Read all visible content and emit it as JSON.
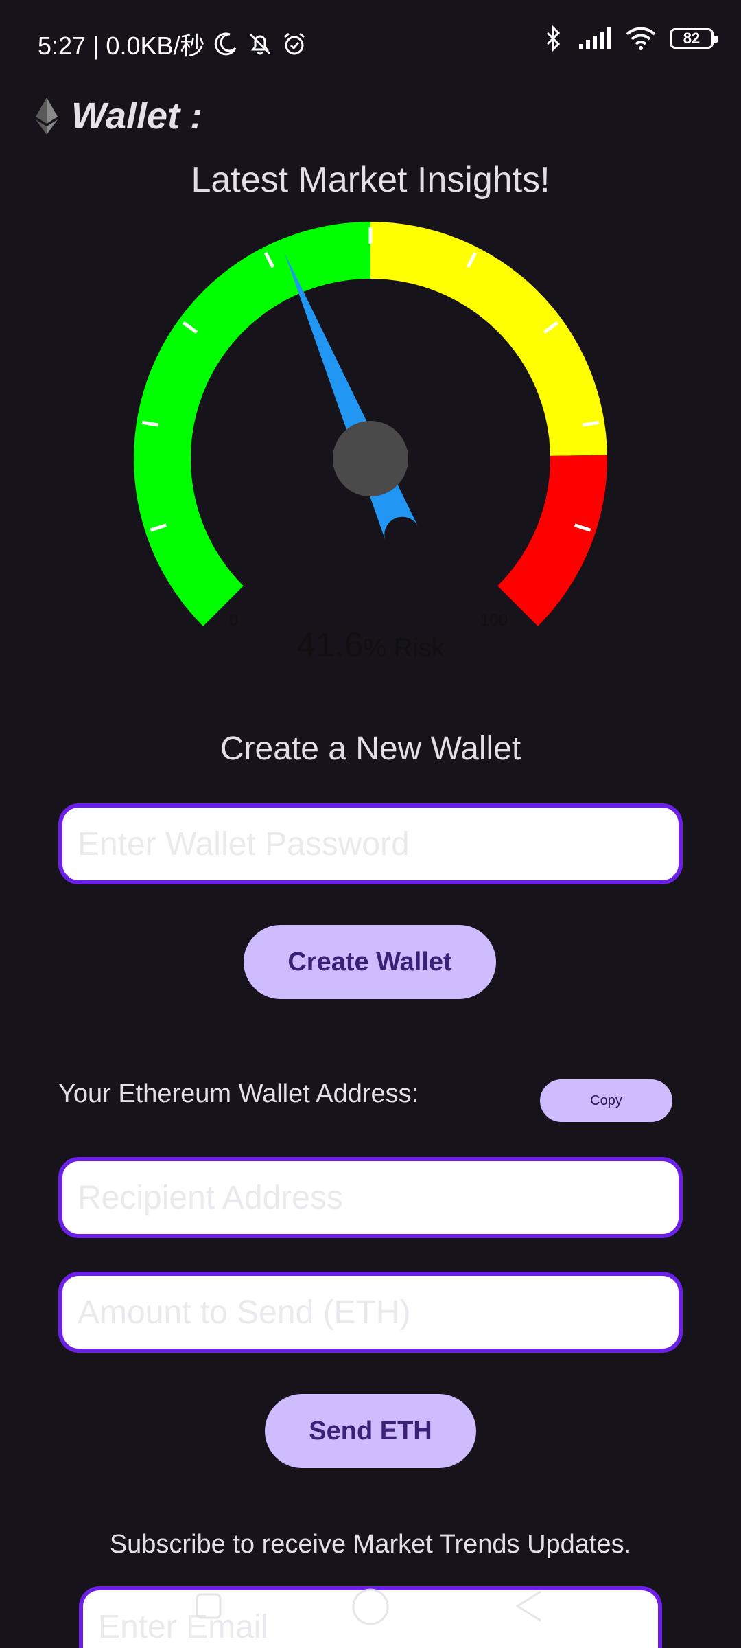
{
  "status_bar": {
    "time_speed": "5:27 | 0.0KB/秒",
    "battery": "82",
    "icons": [
      "moon-icon",
      "notifications-off-icon",
      "alarm-icon",
      "bluetooth-icon",
      "signal-icon",
      "wifi-icon",
      "battery-icon"
    ]
  },
  "header": {
    "title": "Wallet :",
    "logo_icon": "ethereum-icon"
  },
  "insights": {
    "title": "Latest Market Insights!"
  },
  "gauge": {
    "min_label": "0",
    "max_label": "100",
    "value": "41.6",
    "unit_label": "% Risk",
    "risk_percent": 41.6,
    "zones": [
      {
        "color": "#00ff00",
        "from": 0,
        "to": 50
      },
      {
        "color": "#ffff00",
        "from": 50,
        "to": 83
      },
      {
        "color": "#ff0000",
        "from": 83,
        "to": 100
      }
    ],
    "needle_color": "#2196f3",
    "hub_color": "#4a4a4a"
  },
  "create_wallet": {
    "title": "Create a New Wallet",
    "password_placeholder": "Enter Wallet Password",
    "button_label": "Create Wallet"
  },
  "wallet_address": {
    "label": "Your Ethereum Wallet Address:",
    "copy_label": "Copy"
  },
  "send": {
    "recipient_placeholder": "Recipient Address",
    "amount_placeholder": "Amount to Send (ETH)",
    "button_label": "Send ETH"
  },
  "subscribe": {
    "text": "Subscribe to receive Market Trends Updates.",
    "email_placeholder": "Enter Email"
  },
  "colors": {
    "background": "#16131a",
    "accent_border": "#6c1fe6",
    "button_fill": "#cfbcff",
    "button_text": "#3a2176"
  }
}
